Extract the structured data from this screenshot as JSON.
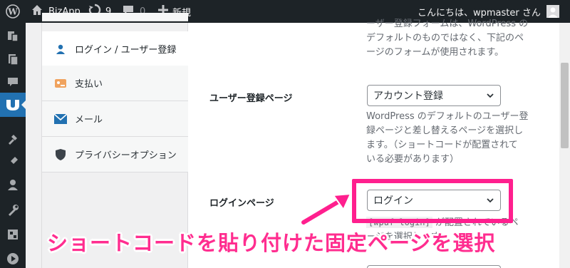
{
  "adminbar": {
    "site_name": "BizApp",
    "updates_count": "9",
    "comments_count": "0",
    "new_label": "新規",
    "greeting": "こんにちは、wpmaster さん"
  },
  "tabs": [
    {
      "label": "ログイン / ユーザー登録",
      "icon": "user-icon",
      "active": true
    },
    {
      "label": "支払い",
      "icon": "payment-icon",
      "active": false
    },
    {
      "label": "メール",
      "icon": "mail-icon",
      "active": false
    },
    {
      "label": "プライバシーオプション",
      "icon": "shield-icon",
      "active": false
    }
  ],
  "content": {
    "top_desc_line1": "ーザー登録フォームは、WordPress の",
    "top_desc_line2": "デフォルトのものではなく、下記のペ",
    "top_desc_line3": "ージのフォームが使用されます。",
    "registration": {
      "label": "ユーザー登録ページ",
      "value": "アカウント登録",
      "desc_line1": "WordPress のデフォルトのユーザー登",
      "desc_line2": "録ページと差し替えるページを選択し",
      "desc_line3": "ます。（ショートコードが配置されて",
      "desc_line4": "いる必要があります）"
    },
    "login": {
      "label": "ログインページ",
      "value": "ログイン",
      "code": "[wpuf-login]",
      "desc_line1_tail": "が配置されているペ",
      "desc_line2": "ージを選択します"
    }
  },
  "annotation": {
    "banner": "ショートコードを貼り付けた固定ページを選択",
    "color": "#ff1f8e"
  }
}
